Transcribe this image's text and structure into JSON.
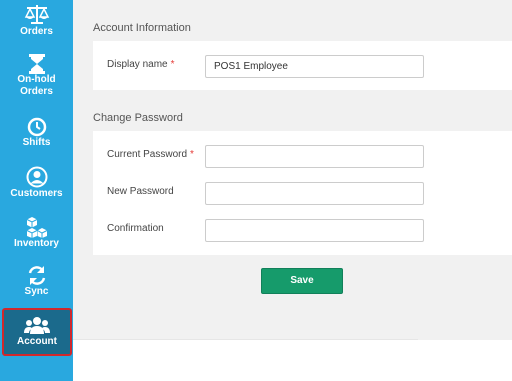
{
  "sidebar": {
    "items": [
      {
        "label": "Orders",
        "icon": "scales-icon"
      },
      {
        "label": "On-hold Orders",
        "icon": "hourglass-icon"
      },
      {
        "label": "Shifts",
        "icon": "clock-icon"
      },
      {
        "label": "Customers",
        "icon": "user-icon"
      },
      {
        "label": "Inventory",
        "icon": "boxes-icon"
      },
      {
        "label": "Sync",
        "icon": "refresh-icon"
      },
      {
        "label": "Account",
        "icon": "users-icon"
      }
    ],
    "active": "Account",
    "colors": {
      "background": "#29a8df",
      "active_background": "#1b6a8c",
      "highlight_border": "#d0282c"
    }
  },
  "account_info": {
    "title": "Account Information",
    "display_name": {
      "label": "Display name",
      "required": "*",
      "value": "POS1 Employee"
    }
  },
  "change_password": {
    "title": "Change Password",
    "current_password": {
      "label": "Current Password",
      "required": "*",
      "value": ""
    },
    "new_password": {
      "label": "New Password",
      "value": ""
    },
    "confirmation": {
      "label": "Confirmation",
      "value": ""
    }
  },
  "save_label": "Save",
  "colors": {
    "save_button": "#169b6b",
    "required_marker": "#e53935"
  }
}
